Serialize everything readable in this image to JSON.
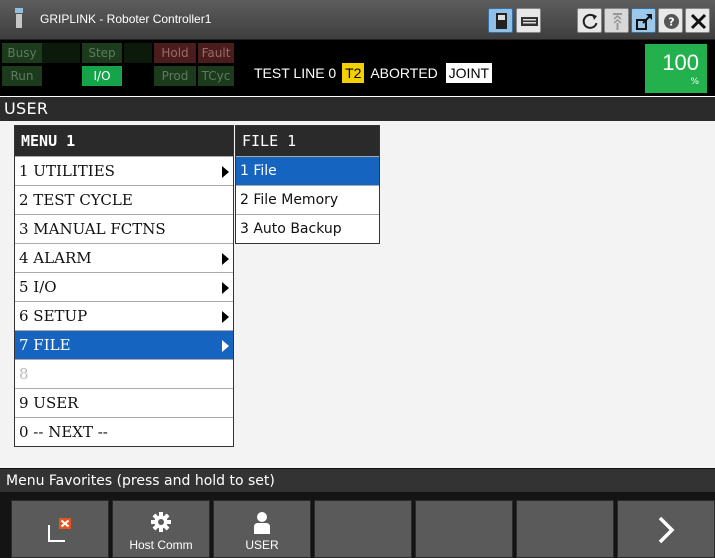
{
  "title_bar": {
    "app_title": "GRIPLINK - Roboter Controller1",
    "icons": [
      "app-logo-icon",
      "tp-panel-icon",
      "keyboard-icon",
      "refresh-icon",
      "jog-speed-icon",
      "maximize-icon",
      "help-icon",
      "close-icon"
    ]
  },
  "status": {
    "lamps": {
      "busy": "Busy",
      "step": "Step",
      "hold": "Hold",
      "fault": "Fault",
      "run": "Run",
      "io": "I/O",
      "prod": "Prod",
      "tcyc": "TCyc"
    },
    "program": "TEST LINE 0",
    "mode": "T2",
    "state": "ABORTED",
    "motion": "JOINT",
    "override_value": "100",
    "override_unit": "%"
  },
  "screen_title": "USER",
  "menu1": {
    "header": "MENU  1",
    "items": [
      {
        "label": "1 UTILITIES",
        "submenu": true
      },
      {
        "label": "2 TEST CYCLE",
        "submenu": false
      },
      {
        "label": "3 MANUAL FCTNS",
        "submenu": false
      },
      {
        "label": "4 ALARM",
        "submenu": true
      },
      {
        "label": "5 I/O",
        "submenu": true
      },
      {
        "label": "6 SETUP",
        "submenu": true
      },
      {
        "label": "7 FILE",
        "submenu": true,
        "selected": true
      },
      {
        "label": "8",
        "submenu": false,
        "disabled": true
      },
      {
        "label": "9 USER",
        "submenu": false
      },
      {
        "label": "0 -- NEXT --",
        "submenu": false
      }
    ]
  },
  "file_menu": {
    "header": "FILE  1",
    "items": [
      {
        "label": "1 File",
        "selected": true
      },
      {
        "label": "2 File Memory"
      },
      {
        "label": "3 Auto Backup"
      }
    ]
  },
  "favorites_bar": "Menu Favorites (press and hold to set)",
  "function_keys": [
    {
      "label": "",
      "icon": "delete-favorite-icon"
    },
    {
      "label": "Host Comm",
      "icon": "gear-icon"
    },
    {
      "label": "USER",
      "icon": "user-icon"
    },
    {
      "label": "",
      "icon": ""
    },
    {
      "label": "",
      "icon": ""
    },
    {
      "label": "",
      "icon": ""
    },
    {
      "label": "",
      "icon": "chevron-right-icon"
    }
  ],
  "colors": {
    "selection": "#1565c0",
    "override_green": "#22b14c",
    "mode_yellow": "#f4d000"
  }
}
